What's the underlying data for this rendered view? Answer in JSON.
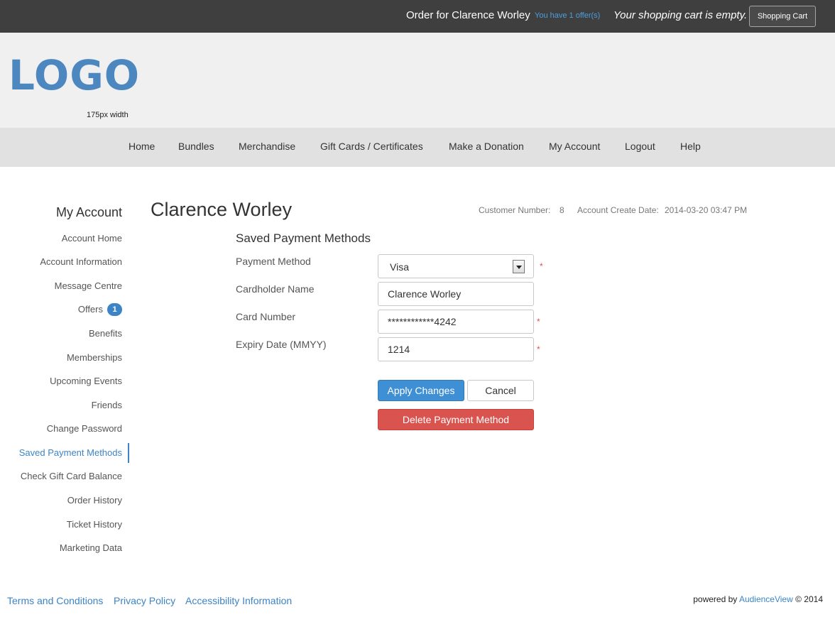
{
  "topbar": {
    "order_text": "Order for Clarence Worley",
    "offers_text": "You have 1 offer(s)",
    "cart_status": "Your shopping cart is empty.",
    "cart_button": "Shopping Cart"
  },
  "header": {
    "logo_text": "LOGO",
    "logo_caption": "175px width"
  },
  "nav": {
    "items": [
      "Home",
      "Bundles",
      "Merchandise",
      "Gift Cards / Certificates",
      "Make a Donation",
      "My Account",
      "Logout",
      "Help"
    ]
  },
  "sidebar": {
    "title": "My Account",
    "items": [
      {
        "label": "Account Home"
      },
      {
        "label": "Account Information"
      },
      {
        "label": "Message Centre"
      },
      {
        "label": "Offers",
        "badge": "1"
      },
      {
        "label": "Benefits"
      },
      {
        "label": "Memberships"
      },
      {
        "label": "Upcoming Events"
      },
      {
        "label": "Friends"
      },
      {
        "label": "Change Password"
      },
      {
        "label": "Saved Payment Methods",
        "active": true
      },
      {
        "label": "Check Gift Card Balance"
      },
      {
        "label": "Order History"
      },
      {
        "label": "Ticket History"
      },
      {
        "label": "Marketing Data"
      }
    ]
  },
  "main": {
    "customer_name": "Clarence Worley",
    "customer_number_label": "Customer Number:",
    "customer_number": "8",
    "create_date_label": "Account Create Date:",
    "create_date": "2014-03-20 03:47 PM",
    "section_title": "Saved Payment Methods",
    "form": {
      "payment_method_label": "Payment Method",
      "payment_method_value": "Visa",
      "cardholder_label": "Cardholder Name",
      "cardholder_value": "Clarence Worley",
      "card_number_label": "Card Number",
      "card_number_value": "************4242",
      "expiry_label": "Expiry Date (MMYY)",
      "expiry_value": "1214",
      "required_mark": "*"
    },
    "buttons": {
      "apply": "Apply Changes",
      "cancel": "Cancel",
      "delete": "Delete Payment Method"
    }
  },
  "footer": {
    "links": [
      "Terms and Conditions",
      "Privacy Policy",
      "Accessibility Information"
    ],
    "powered_prefix": "powered by",
    "powered_brand": "AudienceView",
    "powered_suffix": "© 2014"
  },
  "colors": {
    "topbar_bg": "#3f3f3f",
    "header_bg": "#f0f0f0",
    "nav_bg": "#e1e1e1",
    "accent": "#3c84c6",
    "danger": "#d9534f",
    "logo": "#4c87bf"
  }
}
